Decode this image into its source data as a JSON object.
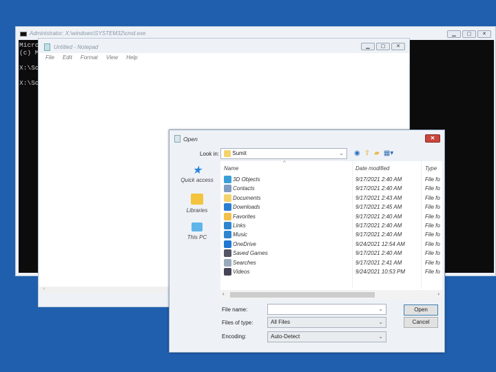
{
  "cmd": {
    "title": "Administrator: X:\\windows\\SYSTEM32\\cmd.exe",
    "lines": [
      "Micro",
      "(c) M",
      "",
      "X:\\So",
      "",
      "X:\\So"
    ]
  },
  "notepad": {
    "title": "Untitled - Notepad",
    "menu": [
      "File",
      "Edit",
      "Format",
      "View",
      "Help"
    ]
  },
  "dialog": {
    "title": "Open",
    "close": "✕",
    "look_in_label": "Look in:",
    "look_in_value": "Sumit",
    "sidebar": [
      {
        "label": "Quick access",
        "icon": "star-icon"
      },
      {
        "label": "Libraries",
        "icon": "libraries-icon"
      },
      {
        "label": "This PC",
        "icon": "computer-icon"
      }
    ],
    "columns": {
      "name": "Name",
      "date": "Date modified",
      "type": "Type"
    },
    "files": [
      {
        "name": "3D Objects",
        "date": "9/17/2021 2:40 AM",
        "type": "File folder",
        "color": "#3a9fd8"
      },
      {
        "name": "Contacts",
        "date": "9/17/2021 2:40 AM",
        "type": "File folder",
        "color": "#7f9cc4"
      },
      {
        "name": "Documents",
        "date": "9/17/2021 2:43 AM",
        "type": "File folder",
        "color": "#f5d36b"
      },
      {
        "name": "Downloads",
        "date": "9/17/2021 2:45 AM",
        "type": "File folder",
        "color": "#2a7fd4"
      },
      {
        "name": "Favorites",
        "date": "9/17/2021 2:40 AM",
        "type": "File folder",
        "color": "#f2c04a"
      },
      {
        "name": "Links",
        "date": "9/17/2021 2:40 AM",
        "type": "File folder",
        "color": "#2f86d0"
      },
      {
        "name": "Music",
        "date": "9/17/2021 2:40 AM",
        "type": "File folder",
        "color": "#2f86d0"
      },
      {
        "name": "OneDrive",
        "date": "9/24/2021 12:54 AM",
        "type": "File folder",
        "color": "#1f78d1"
      },
      {
        "name": "Saved Games",
        "date": "9/17/2021 2:40 AM",
        "type": "File folder",
        "color": "#556"
      },
      {
        "name": "Searches",
        "date": "9/17/2021 2:41 AM",
        "type": "File folder",
        "color": "#9ab"
      },
      {
        "name": "Videos",
        "date": "9/24/2021 10:53 PM",
        "type": "File folder",
        "color": "#445"
      }
    ],
    "file_name_label": "File name:",
    "file_name_value": "",
    "files_of_type_label": "Files of type:",
    "files_of_type_value": "All Files",
    "encoding_label": "Encoding:",
    "encoding_value": "Auto-Detect",
    "open_button": "Open",
    "cancel_button": "Cancel"
  }
}
